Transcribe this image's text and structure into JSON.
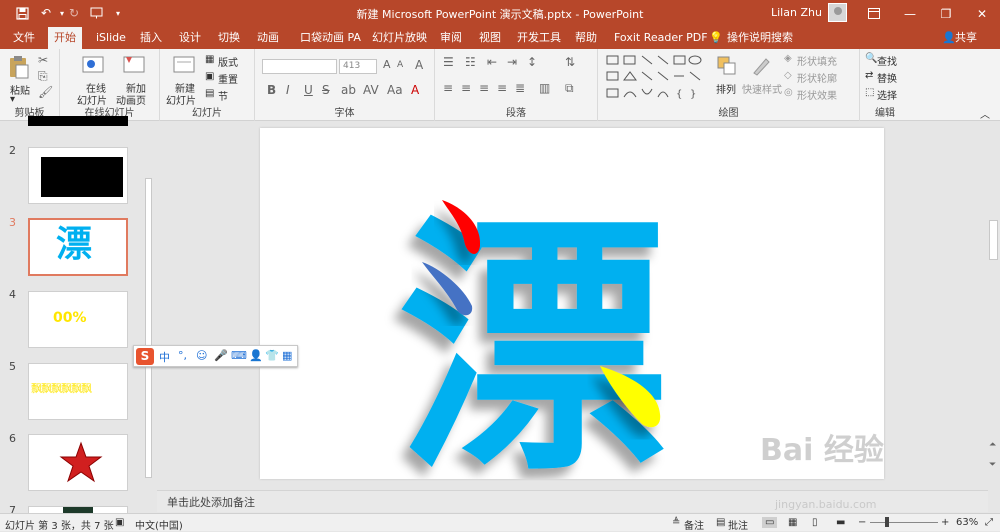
{
  "titlebar": {
    "title": "新建 Microsoft PowerPoint 演示文稿.pptx  -  PowerPoint",
    "user": "Lilan Zhu",
    "save_icon": "save-icon",
    "undo_icon": "undo-icon",
    "redo_icon": "redo-icon",
    "present_icon": "present-from-start-icon",
    "customize_icon": "customize-toolbar-icon"
  },
  "tabs": {
    "file": "文件",
    "home": "开始",
    "islide": "iSlide",
    "insert": "插入",
    "design": "设计",
    "transitions": "切换",
    "animations": "动画",
    "pocket": "口袋动画 PA",
    "slideshow": "幻灯片放映",
    "review": "审阅",
    "view": "视图",
    "developer": "开发工具",
    "help": "帮助",
    "foxit": "Foxit Reader PDF",
    "tellme": "操作说明搜索",
    "share": "共享"
  },
  "ribbon": {
    "clipboard": {
      "paste": "粘贴",
      "label": "剪贴板"
    },
    "online": {
      "online_slide": "在线",
      "online_slide2": "幻灯片",
      "new_anim": "新加",
      "new_anim2": "动画页",
      "label": "在线幻灯片"
    },
    "slides": {
      "new_slide": "新建",
      "new_slide2": "幻灯片",
      "layout": "版式",
      "reset": "重置",
      "section": "节",
      "label": "幻灯片"
    },
    "font": {
      "size": "413",
      "bold": "B",
      "italic": "I",
      "underline": "U",
      "strike": "S",
      "label": "字体"
    },
    "paragraph": {
      "label": "段落"
    },
    "drawing": {
      "arrange": "排列",
      "quick_styles": "快速样式",
      "fill": "形状填充",
      "outline": "形状轮廓",
      "effects": "形状效果",
      "label": "绘图"
    },
    "editing": {
      "find": "查找",
      "replace": "替换",
      "select": "选择",
      "label": "编辑"
    }
  },
  "thumbnails": {
    "n2": "2",
    "n3": "3",
    "n4": "4",
    "n5": "5",
    "n6": "6",
    "n7": "7",
    "t3_text": "漂",
    "t4_text": "00%",
    "t5_text": "飘飘飘飘飘飘"
  },
  "slide": {
    "character": "漂",
    "text_color": "#00b0f0",
    "accent_red": "#ff0000",
    "accent_blue": "#4472c4",
    "accent_yellow": "#ffff00"
  },
  "ime": {
    "logo": "S",
    "mode": "中",
    "punct": "°,"
  },
  "notes": {
    "placeholder": "单击此处添加备注"
  },
  "statusbar": {
    "slide_info": "幻灯片 第 3 张，共 7 张",
    "language": "中文(中国)",
    "notes": "备注",
    "comments": "批注",
    "zoom": "63%"
  },
  "watermark": {
    "logo": "Bai 经验",
    "url": "jingyan.baidu.com"
  }
}
